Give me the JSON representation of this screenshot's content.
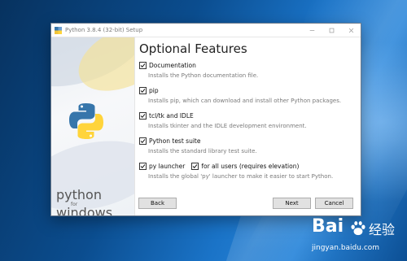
{
  "window": {
    "title": "Python 3.8.4 (32-bit) Setup",
    "controls": {
      "minimize_icon": "minimize-icon",
      "maximize_icon": "maximize-icon",
      "close_icon": "close-icon"
    }
  },
  "sidebar": {
    "brand_line1": "python",
    "brand_line2": "for",
    "brand_line3": "windows"
  },
  "page": {
    "title": "Optional Features"
  },
  "options": [
    {
      "label": "Documentation",
      "checked": true,
      "description": "Installs the Python documentation file."
    },
    {
      "label": "pip",
      "checked": true,
      "description": "Installs pip, which can download and install other Python packages."
    },
    {
      "label": "tcl/tk and IDLE",
      "checked": true,
      "description": "Installs tkinter and the IDLE development environment."
    },
    {
      "label": "Python test suite",
      "checked": true,
      "description": "Installs the standard library test suite."
    },
    {
      "label": "py launcher",
      "checked": true,
      "secondary_label": "for all users (requires elevation)",
      "secondary_checked": true,
      "description": "Installs the global 'py' launcher to make it easier to start Python."
    }
  ],
  "buttons": {
    "back": "Back",
    "next": "Next",
    "cancel": "Cancel"
  },
  "watermark": {
    "brand": "Bai",
    "brand_suffix": "经验",
    "url": "jingyan.baidu.com"
  },
  "colors": {
    "desktop_blue": "#0b4d8f",
    "python_blue": "#3776ab",
    "python_yellow": "#ffd43b"
  }
}
